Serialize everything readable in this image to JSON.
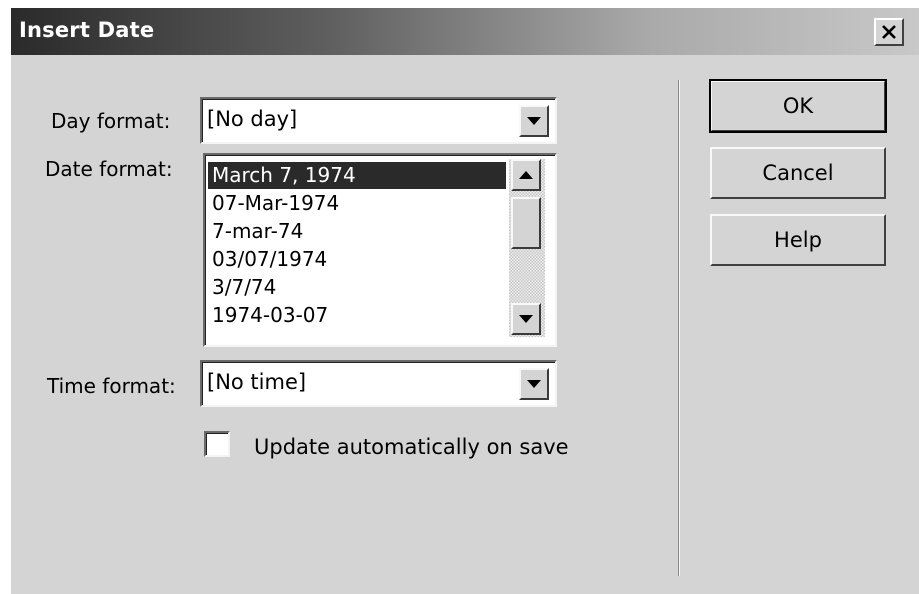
{
  "window": {
    "title": "Insert Date",
    "close_icon": "close-icon"
  },
  "form": {
    "day_format": {
      "label": "Day format:",
      "selected": "[No day]"
    },
    "date_format": {
      "label": "Date format:",
      "options": [
        "March 7, 1974",
        "07-Mar-1974",
        "7-mar-74",
        "03/07/1974",
        "3/7/74",
        "1974-03-07"
      ],
      "selected_index": 0,
      "scroll_position": 0.1
    },
    "time_format": {
      "label": "Time format:",
      "selected": "[No time]"
    },
    "update_checkbox": {
      "label": "Update automatically on save",
      "checked": false
    }
  },
  "buttons": {
    "ok": "OK",
    "cancel": "Cancel",
    "help": "Help"
  },
  "colors": {
    "face": "#d4d4d4",
    "selection": "#2a2a2a",
    "title_start": "#2a2a2a",
    "title_end": "#c8c8c8"
  }
}
